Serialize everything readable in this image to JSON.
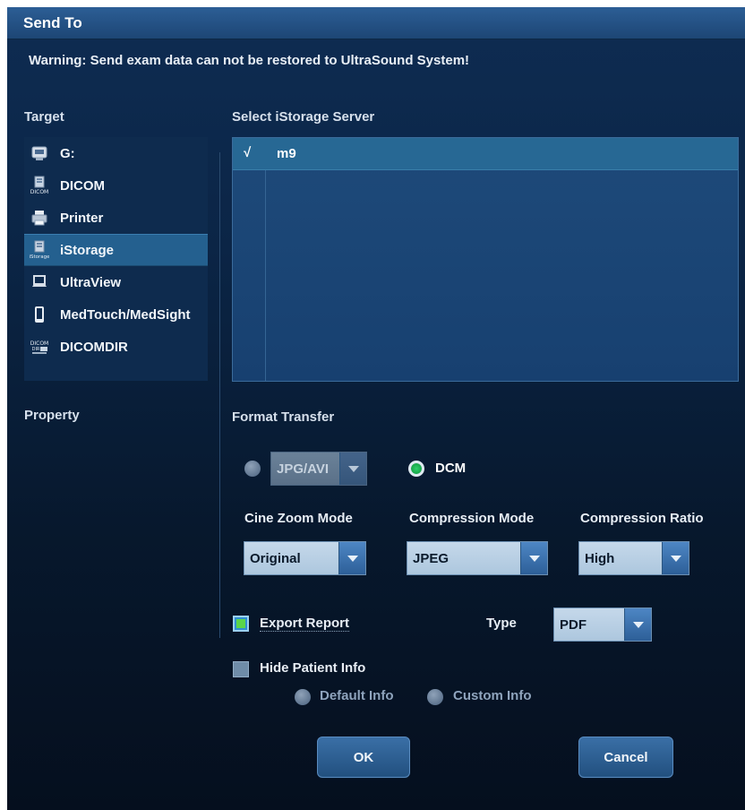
{
  "dialog": {
    "title": "Send To",
    "warning": "Warning: Send exam data can not be restored to UltraSound System!"
  },
  "target": {
    "title": "Target",
    "items": [
      {
        "label": "G:",
        "icon": "usb-drive-icon"
      },
      {
        "label": "DICOM",
        "icon": "dicom-icon"
      },
      {
        "label": "Printer",
        "icon": "printer-icon"
      },
      {
        "label": "iStorage",
        "icon": "istorage-icon",
        "selected": true
      },
      {
        "label": "UltraView",
        "icon": "laptop-icon"
      },
      {
        "label": "MedTouch/MedSight",
        "icon": "mobile-phone-icon"
      },
      {
        "label": "DICOMDIR",
        "icon": "dicomdir-icon"
      }
    ]
  },
  "property": {
    "title": "Property"
  },
  "server": {
    "title": "Select iStorage Server",
    "rows": [
      {
        "checked": "√",
        "name": "m9"
      }
    ]
  },
  "format": {
    "title": "Format Transfer",
    "jpg_avi_label": "JPG/AVI",
    "dcm_label": "DCM",
    "cine_zoom_label": "Cine Zoom Mode",
    "cine_zoom_value": "Original",
    "compression_mode_label": "Compression Mode",
    "compression_mode_value": "JPEG",
    "compression_ratio_label": "Compression Ratio",
    "compression_ratio_value": "High",
    "export_report_label": "Export Report",
    "export_report_checked": true,
    "type_label": "Type",
    "type_value": "PDF",
    "hide_patient_label": "Hide Patient Info",
    "hide_patient_checked": false,
    "default_info_label": "Default Info",
    "custom_info_label": "Custom Info"
  },
  "buttons": {
    "ok": "OK",
    "cancel": "Cancel"
  },
  "colors": {
    "title_bar": "#2a5a8f",
    "background": "#0b2546",
    "selection": "#24608f",
    "dropdown_field": "#b9d0e4",
    "radio_active": "#1fbf5a"
  }
}
